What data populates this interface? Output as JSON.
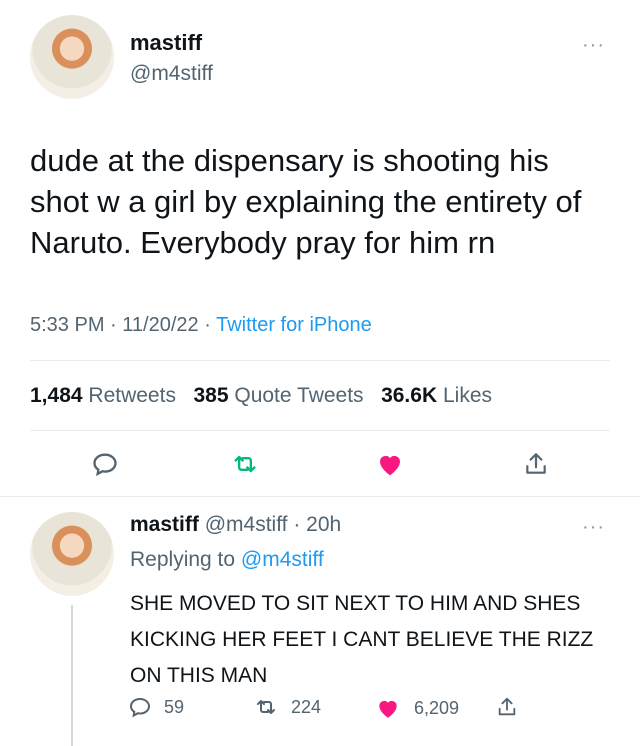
{
  "tweet": {
    "display_name": "mastiff",
    "handle": "@m4stiff",
    "text": "dude at the dispensary is shooting his shot w a girl by explaining the entirety of Naruto. Everybody pray for him rn",
    "time": "5:33 PM",
    "date": "11/20/22",
    "sep": "·",
    "source": "Twitter for iPhone",
    "more": "···"
  },
  "stats": {
    "retweets_count": "1,484",
    "retweets_label": "Retweets",
    "quotes_count": "385",
    "quotes_label": "Quote Tweets",
    "likes_count": "36.6K",
    "likes_label": "Likes"
  },
  "actions": {
    "reply_icon": "reply-icon",
    "retweet_icon": "retweet-icon",
    "like_icon": "heart-icon",
    "share_icon": "share-icon"
  },
  "reply": {
    "display_name": "mastiff",
    "handle": "@m4stiff",
    "sep": "·",
    "age": "20h",
    "replying_label": "Replying to",
    "replying_handle": "@m4stiff",
    "text": "SHE MOVED TO SIT NEXT TO HIM AND SHES KICKING HER FEET I CANT BELIEVE THE RIZZ ON THIS MAN",
    "replies": "59",
    "retweets": "224",
    "likes": "6,209",
    "more": "···"
  },
  "colors": {
    "accent": "#1d9bf0",
    "like": "#f91880",
    "retweet": "#00ba7c",
    "text": "#0f1419",
    "muted": "#536471"
  }
}
